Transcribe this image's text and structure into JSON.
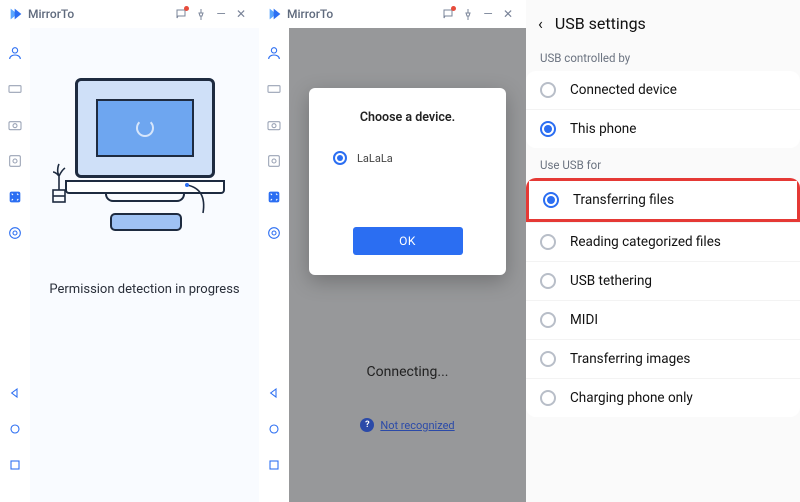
{
  "app_name": "MirrorTo",
  "panel1": {
    "status_text": "Permission detection in progress"
  },
  "panel2": {
    "dialog_title": "Choose a device.",
    "device_name": "LaLaLa",
    "ok_label": "OK",
    "status_text": "Connecting...",
    "not_recognized_label": "Not recognized"
  },
  "panel3": {
    "title": "USB settings",
    "section1_label": "USB controlled by",
    "section2_label": "Use USB for",
    "opt_connected_device": "Connected device",
    "opt_this_phone": "This phone",
    "opt_transferring_files": "Transferring files",
    "opt_reading_categorized": "Reading categorized files",
    "opt_usb_tethering": "USB tethering",
    "opt_midi": "MIDI",
    "opt_transferring_images": "Transferring images",
    "opt_charging_only": "Charging phone only"
  }
}
